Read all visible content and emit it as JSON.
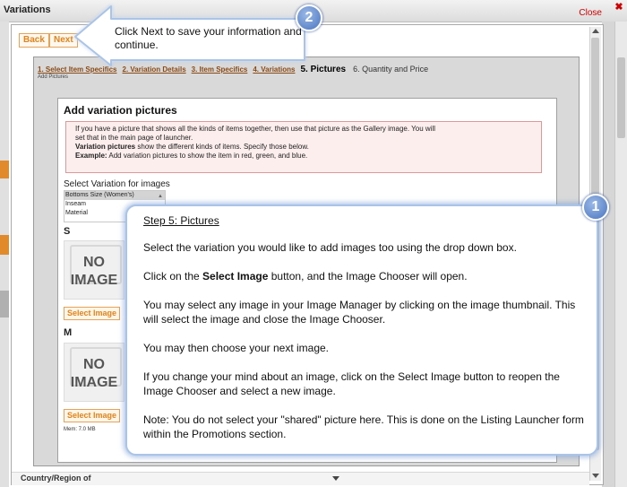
{
  "window": {
    "title": "Variations",
    "close_label": "Close",
    "close_icon": "✖"
  },
  "toolbar": {
    "back_label": "Back",
    "next_label": "Next"
  },
  "wizard": {
    "steps": [
      "1. Select Item Specifics",
      "2. Variation Details",
      "3. Item Specifics",
      "4. Variations"
    ],
    "current_step": "5. Pictures",
    "next_step": "6. Quantity and Price",
    "substep": "Add Pictures"
  },
  "panel": {
    "title": "Add variation pictures",
    "info_line1": "If you have a picture that shows all the kinds of items together, then use that picture as the Gallery image. You will",
    "info_line2": "set that in the main page of launcher.",
    "info_bold1": "Variation pictures",
    "info_line3": " show the different kinds of items. Specify those below.",
    "info_bold2": "Example:",
    "info_line4": " Add variation pictures to show the item in red, green, and blue.",
    "select_label": "Select Variation for images",
    "options": [
      "Bottoms Size (Women's)",
      "Inseam",
      "Material"
    ],
    "variations": [
      {
        "label": "S",
        "noimage_line1": "NO",
        "noimage_line2": "IMAGE",
        "button": "Select Image"
      },
      {
        "label": "M",
        "noimage_line1": "NO",
        "noimage_line2": "IMAGE",
        "button": "Select Image"
      }
    ],
    "mem": "Mem: 7.0 MB"
  },
  "bottom_field": {
    "label": "Country/Region of"
  },
  "callout1": {
    "badge": "1",
    "heading": "Step 5: Pictures",
    "p1": "Select the variation you would like to add images too using the drop down box.",
    "p2_pre": "Click on the ",
    "p2_bold": "Select Image",
    "p2_post": " button, and the Image Chooser will open.",
    "p3": "You may select any image in your Image Manager by clicking on the image thumbnail. This will select the image and close the Image Chooser.",
    "p4": "You may then choose your next image.",
    "p5": "If you change your mind about an image, click on the Select Image button to reopen the Image Chooser and select a new image.",
    "p6": "Note:  You do not select your \"shared\" picture here. This is done on the Listing Launcher form within the Promotions section."
  },
  "callout2": {
    "badge": "2",
    "text": "Click Next to save your information and continue."
  },
  "colors": {
    "accent_orange": "#e5821a",
    "callout_border": "#a9c4e8",
    "badge_blue": "#4a74c0",
    "close_red": "#d40000"
  }
}
